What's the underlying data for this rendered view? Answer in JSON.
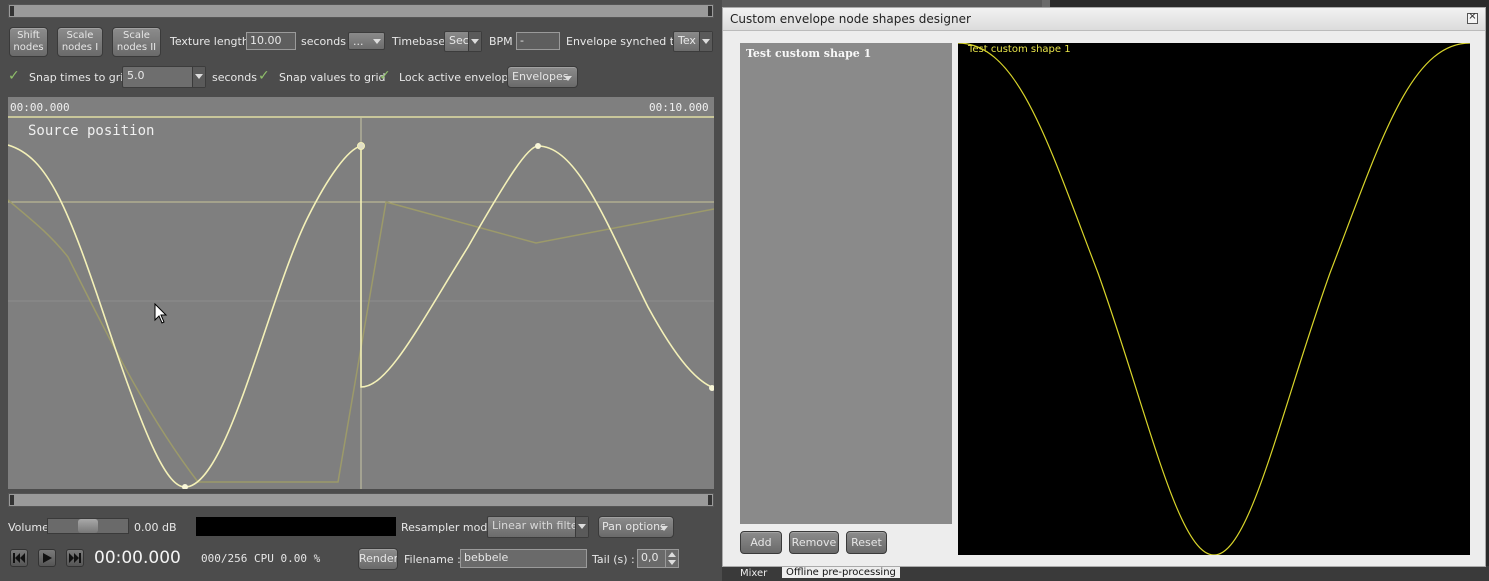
{
  "main": {
    "toolbar": {
      "shift_nodes": [
        "Shift",
        "nodes"
      ],
      "scale_nodes_1": [
        "Scale",
        "nodes I"
      ],
      "scale_nodes_2": [
        "Scale",
        "nodes II"
      ],
      "texture_length_label": "Texture length",
      "texture_length_value": "10.00",
      "seconds_label": "seconds",
      "seconds_combo": "...",
      "timebase_label": "Timebase",
      "timebase_value": "Sec",
      "bpm_label": "BPM",
      "bpm_value": "-",
      "env_synched_label": "Envelope synched to",
      "env_synched_value": "Tex"
    },
    "row2": {
      "snap_times_label": "Snap times to grid",
      "snap_times_value": "5.0",
      "seconds_label": "seconds",
      "snap_values_label": "Snap values to grid",
      "lock_envelope_label": "Lock active envelope",
      "envelopes_button": "Envelopes"
    },
    "timeline": {
      "start_time": "00:00.000",
      "end_time": "00:10.000",
      "envelope_name": "Source position"
    },
    "bottom": {
      "volume_label": "Volume",
      "volume_value": "0.00 dB",
      "resampler_label": "Resampler mode",
      "resampler_value": "Linear with filter",
      "pan_options": "Pan options",
      "time_display": "00:00.000",
      "status": "000/256 CPU 0.00 %",
      "render_button": "Render",
      "filename_label": "Filename :",
      "filename_value": "bebbele",
      "tail_label": "Tail (s) :",
      "tail_value": "0,0"
    },
    "behind_text": "Mixer",
    "behind_text2": "Offline pre-processing"
  },
  "dialog": {
    "title": "Custom envelope node shapes designer",
    "list_items": [
      "Test custom shape 1"
    ],
    "preview_label": "Test custom shape 1",
    "add_button": "Add",
    "remove_button": "Remove",
    "reset_button": "Reset"
  },
  "colors": {
    "curve": "#f4f1b8",
    "preview_curve": "#d8d42a",
    "envelope_bg": "#7f7f7f"
  }
}
